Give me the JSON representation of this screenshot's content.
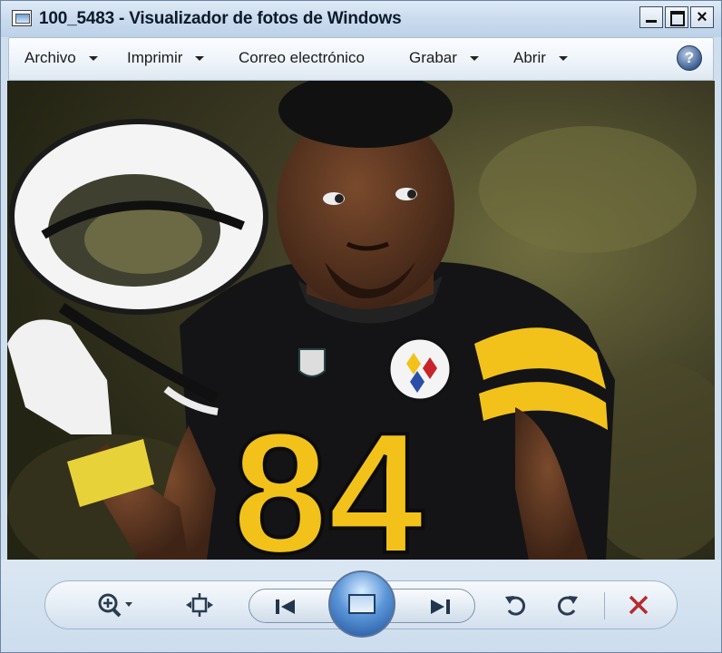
{
  "window": {
    "title": "100_5483 - Visualizador de fotos de Windows"
  },
  "menu": {
    "items": [
      {
        "label": "Archivo",
        "dropdown": true
      },
      {
        "label": "Imprimir",
        "dropdown": true
      },
      {
        "label": "Correo electrónico",
        "dropdown": false
      },
      {
        "label": "Grabar",
        "dropdown": true
      },
      {
        "label": "Abrir",
        "dropdown": true
      }
    ],
    "help_label": "?"
  },
  "photo": {
    "jersey_number": "84",
    "icon": "photo-content"
  },
  "toolbar": {
    "buttons": [
      {
        "name": "zoom",
        "icon": "zoom-icon"
      },
      {
        "name": "actual-size",
        "icon": "fit-window-icon"
      },
      {
        "name": "previous",
        "icon": "previous-icon"
      },
      {
        "name": "slideshow",
        "icon": "slideshow-icon"
      },
      {
        "name": "next",
        "icon": "next-icon"
      },
      {
        "name": "rotate-left",
        "icon": "rotate-ccw-icon"
      },
      {
        "name": "rotate-right",
        "icon": "rotate-cw-icon"
      },
      {
        "name": "delete",
        "icon": "delete-icon"
      }
    ]
  },
  "colors": {
    "accent": "#2a5ea8",
    "delete": "#b42c2c",
    "jersey_yellow": "#f2c21b"
  }
}
